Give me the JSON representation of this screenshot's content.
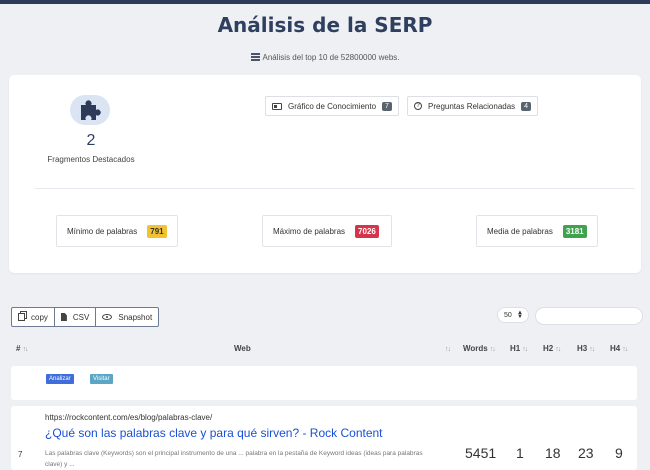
{
  "header": {
    "title": "Análisis de la SERP",
    "subtitle": "Análisis del top 10 de 52800000 webs."
  },
  "summary": {
    "featured_count": "2",
    "featured_label": "Fragmentos Destacados",
    "knowledge_graph": {
      "label": "Gráfico de Conocimiento",
      "badge": "7"
    },
    "related_questions": {
      "label": "Preguntas Relacionadas",
      "badge": "4"
    },
    "stats": [
      {
        "label": "Mínimo de palabras",
        "value": "791",
        "color": "#f2c230"
      },
      {
        "label": "Máximo de palabras",
        "value": "7026",
        "color": "#d6334c"
      },
      {
        "label": "Media de palabras",
        "value": "3181",
        "color": "#3fa34d"
      }
    ]
  },
  "toolbar": {
    "copy_label": "copy",
    "csv_label": "CSV",
    "snapshot_label": "Snapshot",
    "page_size": "50",
    "search_value": ""
  },
  "table": {
    "headers": [
      "#",
      "Web",
      "Words",
      "H1",
      "H2",
      "H3",
      "H4"
    ],
    "row_actions": {
      "analyze": "Analizar",
      "visit": "Visitar"
    },
    "rows": [
      {
        "num": "7",
        "url": "https://rockcontent.com/es/blog/palabras-clave/",
        "title": "¿Qué son las palabras clave y para qué sirven? - Rock Content",
        "description": "Las palabras clave (Keywords) son el principal instrumento de una ... palabra en la pestaña de Keyword ideas (ideas para palabras clave) y ...",
        "words": "5451",
        "h1": "1",
        "h2": "18",
        "h3": "23",
        "h4": "9"
      }
    ]
  },
  "colors": {
    "accent": "#2f3f60",
    "link": "#1a4fd6",
    "background": "#eef0f4"
  }
}
